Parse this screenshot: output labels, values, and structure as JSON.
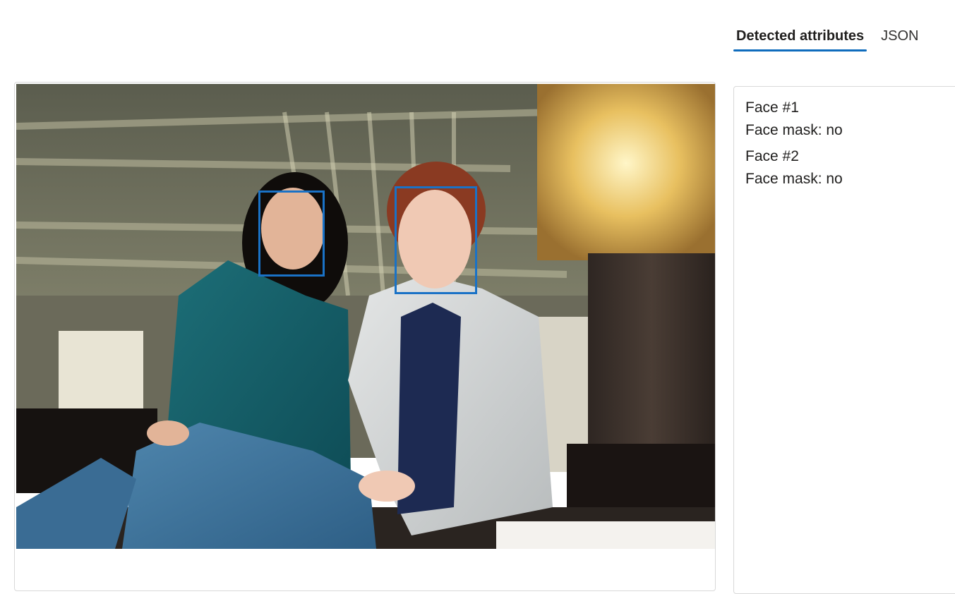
{
  "tabs": [
    {
      "label": "Detected attributes",
      "active": true
    },
    {
      "label": "JSON",
      "active": false
    }
  ],
  "image": {
    "description_icon": "photo-two-women-office",
    "faces_boxed": 2
  },
  "results": {
    "faces": [
      {
        "title": "Face #1",
        "attribute": "Face mask: no"
      },
      {
        "title": "Face #2",
        "attribute": "Face mask: no"
      }
    ]
  },
  "colors": {
    "accent": "#0f6cbd",
    "face_box": "#1a72c6",
    "border": "#d9d9d9"
  }
}
